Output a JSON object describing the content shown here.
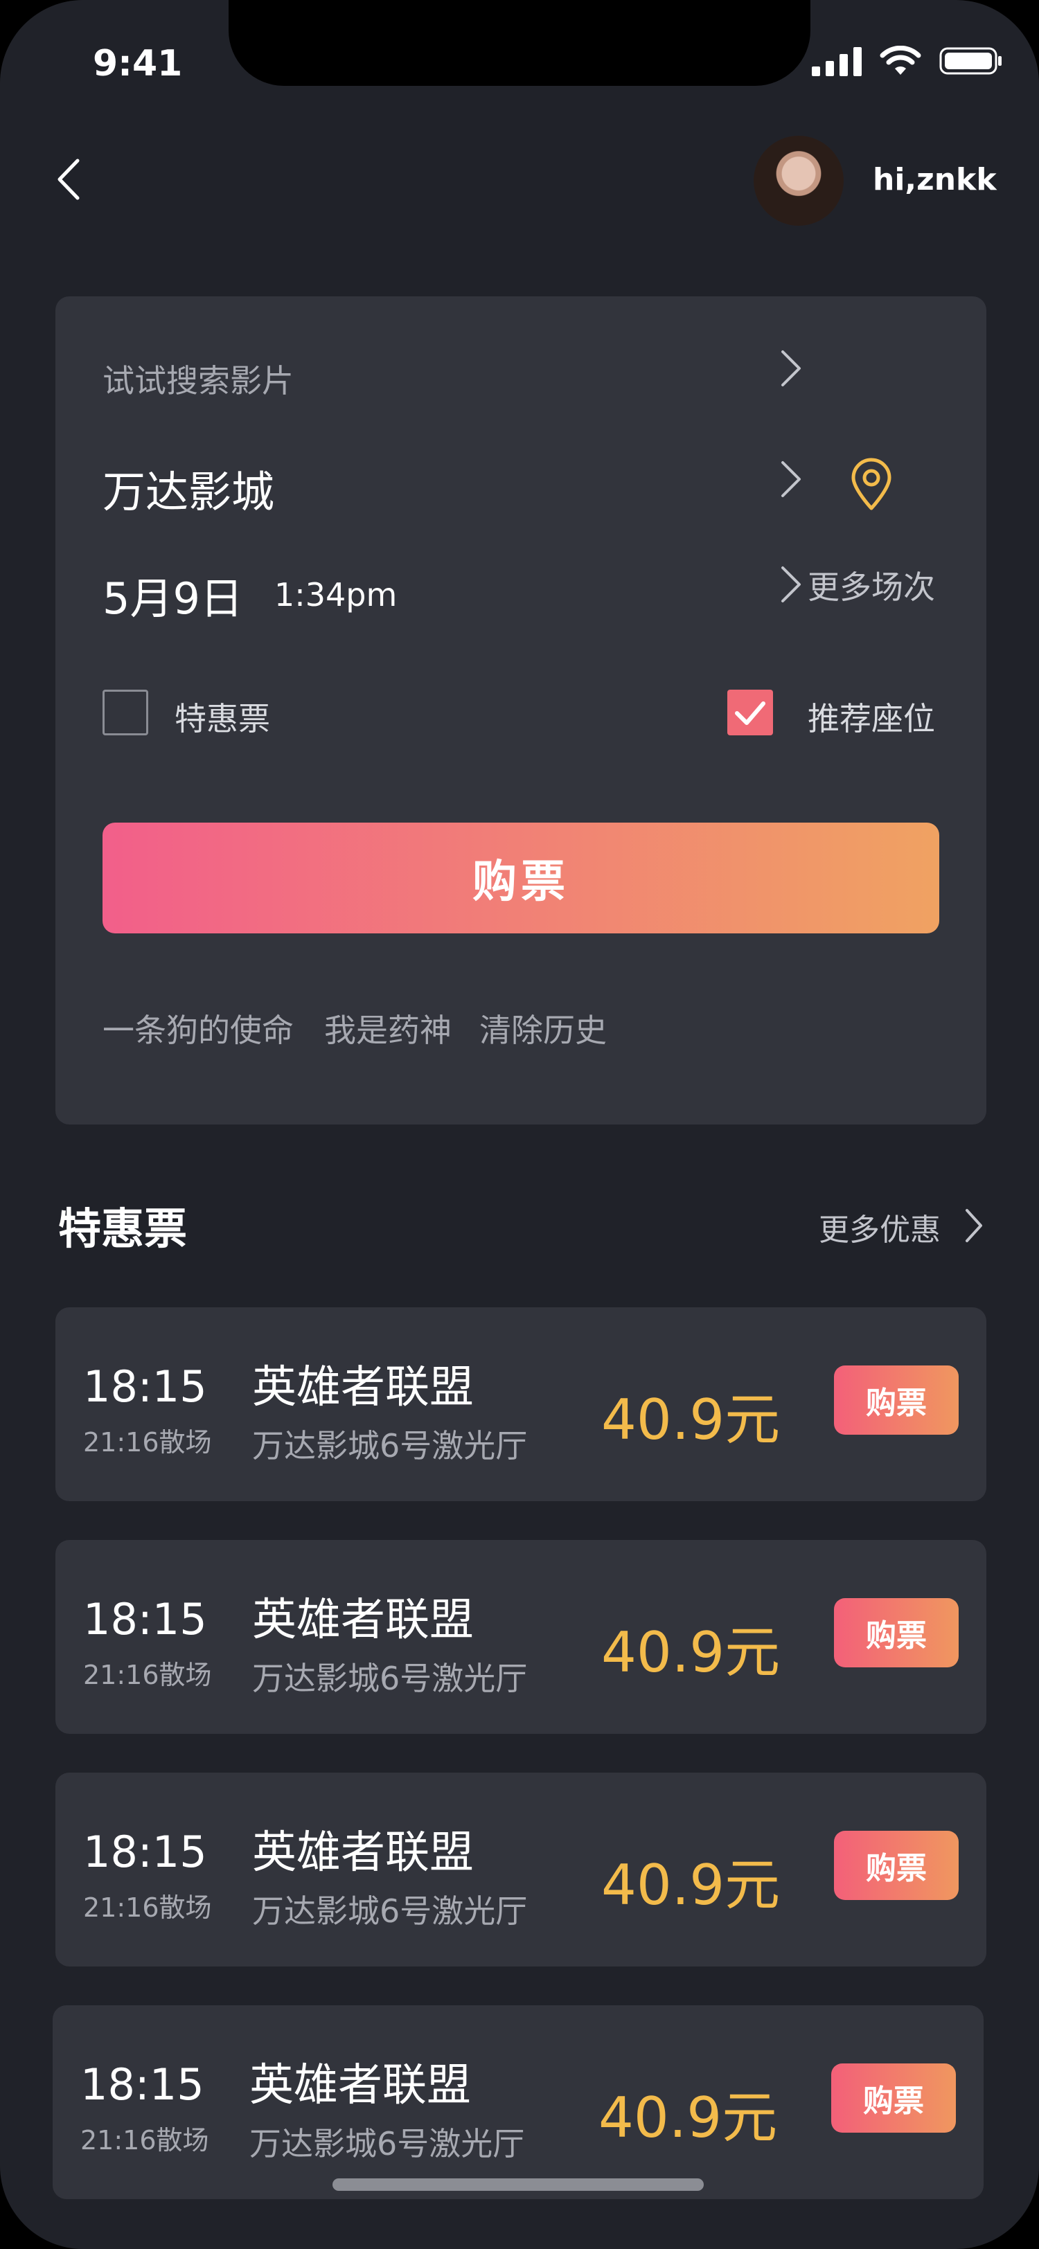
{
  "status_bar": {
    "time": "9:41"
  },
  "header": {
    "greeting": "hi,znkk"
  },
  "search_card": {
    "search_placeholder": "试试搜索影片",
    "cinema": "万达影城",
    "date": "5月9日",
    "showtime": "1:34pm",
    "more_sessions": "更多场次",
    "discount_label": "特惠票",
    "discount_checked": false,
    "recommend_label": "推荐座位",
    "recommend_checked": true,
    "buy_label": "购票",
    "history": [
      "一条狗的使命",
      "我是药神",
      "清除历史"
    ]
  },
  "deals": {
    "title": "特惠票",
    "more_label": "更多优惠",
    "items": [
      {
        "start": "18:15",
        "end": "21:16散场",
        "movie": "英雄者联盟",
        "hall": "万达影城6号激光厅",
        "price": "40.9元",
        "buy": "购票"
      },
      {
        "start": "18:15",
        "end": "21:16散场",
        "movie": "英雄者联盟",
        "hall": "万达影城6号激光厅",
        "price": "40.9元",
        "buy": "购票"
      },
      {
        "start": "18:15",
        "end": "21:16散场",
        "movie": "英雄者联盟",
        "hall": "万达影城6号激光厅",
        "price": "40.9元",
        "buy": "购票"
      },
      {
        "start": "18:15",
        "end": "21:16散场",
        "movie": "英雄者联盟",
        "hall": "万达影城6号激光厅",
        "price": "40.9元",
        "buy": "购票"
      }
    ]
  },
  "colors": {
    "background": "#202229",
    "card": "#32343c",
    "price": "#f3bb4b",
    "accent_start": "#f25f8a",
    "accent_end": "#f0a262",
    "location": "#f3bb4b"
  }
}
